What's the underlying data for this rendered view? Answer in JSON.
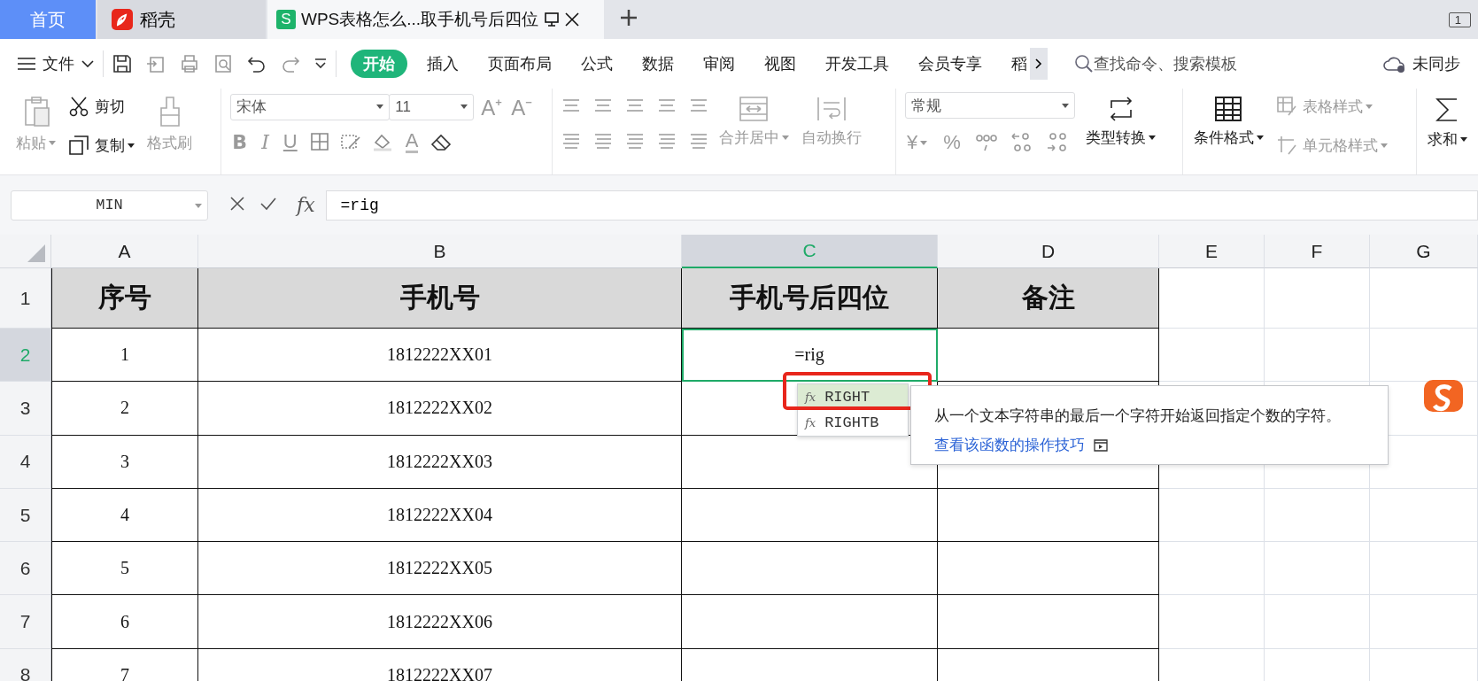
{
  "tabs": [
    {
      "kind": "home",
      "label": "首页",
      "selected": false
    },
    {
      "kind": "docer",
      "label": "稻壳",
      "selected": false
    },
    {
      "kind": "sheet",
      "badge": "S",
      "label": "WPS表格怎么...取手机号后四位",
      "selected": true
    }
  ],
  "window_count": "1",
  "menu": {
    "file": "文件",
    "ribbon_tabs": [
      {
        "label": "开始",
        "selected": true
      },
      {
        "label": "插入",
        "selected": false
      },
      {
        "label": "页面布局",
        "selected": false
      },
      {
        "label": "公式",
        "selected": false
      },
      {
        "label": "数据",
        "selected": false
      },
      {
        "label": "审阅",
        "selected": false
      },
      {
        "label": "视图",
        "selected": false
      },
      {
        "label": "开发工具",
        "selected": false
      },
      {
        "label": "会员专享",
        "selected": false
      },
      {
        "label": "稻",
        "selected": false
      }
    ],
    "search": {
      "placeholder": "查找命令、搜索模板"
    },
    "sync": "未同步"
  },
  "ribbon": {
    "paste": {
      "label": "粘贴",
      "disabled": true
    },
    "cut": {
      "label": "剪切",
      "disabled": false
    },
    "copy": {
      "label": "复制",
      "disabled": false
    },
    "format_painter": {
      "label": "格式刷",
      "disabled": true
    },
    "font": {
      "value": "宋体"
    },
    "font_size": {
      "value": "11"
    },
    "size_buttons": [
      "A⁺",
      "A⁻"
    ],
    "style_buttons": [
      "B",
      "I",
      "U"
    ],
    "font_color": "A",
    "merge": {
      "label": "合并居中",
      "disabled": true
    },
    "wrap": {
      "label": "自动换行",
      "disabled": true
    },
    "number_format": {
      "value": "常规"
    },
    "currency": "¥",
    "percent": "%",
    "convert": {
      "label": "类型转换",
      "disabled": false
    },
    "conditional": {
      "label": "条件格式",
      "disabled": false
    },
    "table_style": {
      "label": "表格样式",
      "disabled": true
    },
    "cell_style": {
      "label": "单元格样式",
      "disabled": true
    },
    "sum": {
      "label": "求和",
      "disabled": false
    }
  },
  "formula_bar": {
    "name_box": "MIN",
    "fx": "fx",
    "formula": "=rig"
  },
  "sheet": {
    "columns": [
      {
        "label": "A",
        "selected": false
      },
      {
        "label": "B",
        "selected": false
      },
      {
        "label": "C",
        "selected": true
      },
      {
        "label": "D",
        "selected": false
      },
      {
        "label": "E",
        "selected": false
      },
      {
        "label": "F",
        "selected": false
      },
      {
        "label": "G",
        "selected": false
      }
    ],
    "rows": [
      {
        "number": "1",
        "selected": false,
        "kind": "header",
        "cells": {
          "A": "序号",
          "B": "手机号",
          "C": "手机号后四位",
          "D": "备注"
        }
      },
      {
        "number": "2",
        "selected": true,
        "kind": "data",
        "cells": {
          "A": "1",
          "B": "1812222XX01",
          "C": "=rig"
        }
      },
      {
        "number": "3",
        "selected": false,
        "kind": "data",
        "cells": {
          "A": "2",
          "B": "1812222XX02"
        }
      },
      {
        "number": "4",
        "selected": false,
        "kind": "data",
        "cells": {
          "A": "3",
          "B": "1812222XX03"
        }
      },
      {
        "number": "5",
        "selected": false,
        "kind": "data",
        "cells": {
          "A": "4",
          "B": "1812222XX04"
        }
      },
      {
        "number": "6",
        "selected": false,
        "kind": "data",
        "cells": {
          "A": "5",
          "B": "1812222XX05"
        }
      },
      {
        "number": "7",
        "selected": false,
        "kind": "data",
        "cells": {
          "A": "6",
          "B": "1812222XX06"
        }
      },
      {
        "number": "8",
        "selected": false,
        "kind": "data",
        "cells": {
          "A": "7",
          "B": "1812222XX07"
        }
      }
    ]
  },
  "autocomplete": {
    "items": [
      {
        "prefix": "fx",
        "name": "RIGHT",
        "selected": true
      },
      {
        "prefix": "fx",
        "name": "RIGHTB",
        "selected": false
      }
    ]
  },
  "tooltip": {
    "description": "从一个文本字符串的最后一个字符开始返回指定个数的字符。",
    "link": "查看该函数的操作技巧"
  }
}
